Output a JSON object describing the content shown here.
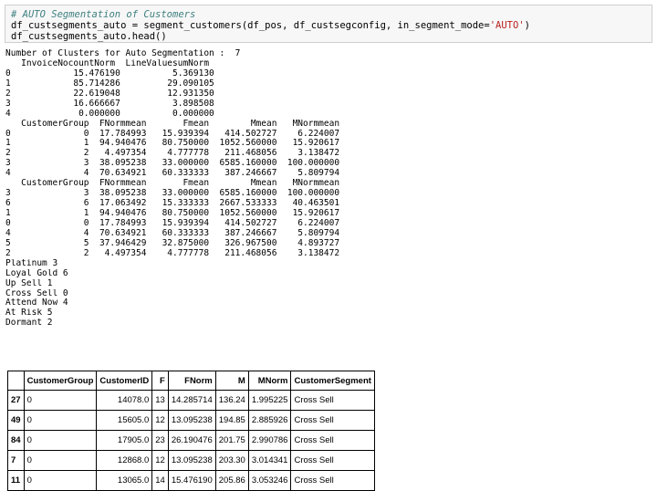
{
  "code": {
    "comment": "# AUTO Segmentation of Customers",
    "line2_pre": "df_custsegments_auto = segment_customers(df_pos, df_custsegconfig, in_segment_mode=",
    "line2_string": "'AUTO'",
    "line2_post": ")",
    "line3": "df_custsegments_auto.head()"
  },
  "output": {
    "lines": [
      "Number of Clusters for Auto Segmentation :  7",
      "   InvoiceNocountNorm  LineValuesumNorm",
      "0            15.476190          5.369130",
      "1            85.714286         29.090105",
      "2            22.619048         12.931350",
      "3            16.666667          3.898508",
      "4             0.000000          0.000000",
      "   CustomerGroup  FNormmean       Fmean        Mmean   MNormmean",
      "0              0  17.784993   15.939394   414.502727    6.224007",
      "1              1  94.940476   80.750000  1052.560000   15.920617",
      "2              2   4.497354    4.777778   211.468056    3.138472",
      "3              3  38.095238   33.000000  6585.160000  100.000000",
      "4              4  70.634921   60.333333   387.246667    5.809794",
      "   CustomerGroup  FNormmean       Fmean        Mmean   MNormmean",
      "3              3  38.095238   33.000000  6585.160000  100.000000",
      "6              6  17.063492   15.333333  2667.533333   40.463501",
      "1              1  94.940476   80.750000  1052.560000   15.920617",
      "0              0  17.784993   15.939394   414.502727    6.224007",
      "4              4  70.634921   60.333333   387.246667    5.809794",
      "5              5  37.946429   32.875000   326.967500    4.893727",
      "2              2   4.497354    4.777778   211.468056    3.138472",
      "Platinum 3",
      "Loyal Gold 6",
      "Up Sell 1",
      "Cross Sell 0",
      "Attend Now 4",
      "At Risk 5",
      "Dormant 2"
    ]
  },
  "table": {
    "columns": [
      "",
      "CustomerGroup",
      "CustomerID",
      "F",
      "FNorm",
      "M",
      "MNorm",
      "CustomerSegment"
    ],
    "rows": [
      [
        "27",
        "0",
        "14078.0",
        "13",
        "14.285714",
        "136.24",
        "1.995225",
        "Cross Sell"
      ],
      [
        "49",
        "0",
        "15605.0",
        "12",
        "13.095238",
        "194.85",
        "2.885926",
        "Cross Sell"
      ],
      [
        "84",
        "0",
        "17905.0",
        "23",
        "26.190476",
        "201.75",
        "2.990786",
        "Cross Sell"
      ],
      [
        "7",
        "0",
        "12868.0",
        "12",
        "13.095238",
        "203.30",
        "3.014341",
        "Cross Sell"
      ],
      [
        "11",
        "0",
        "13065.0",
        "14",
        "15.476190",
        "205.86",
        "3.053246",
        "Cross Sell"
      ]
    ]
  }
}
